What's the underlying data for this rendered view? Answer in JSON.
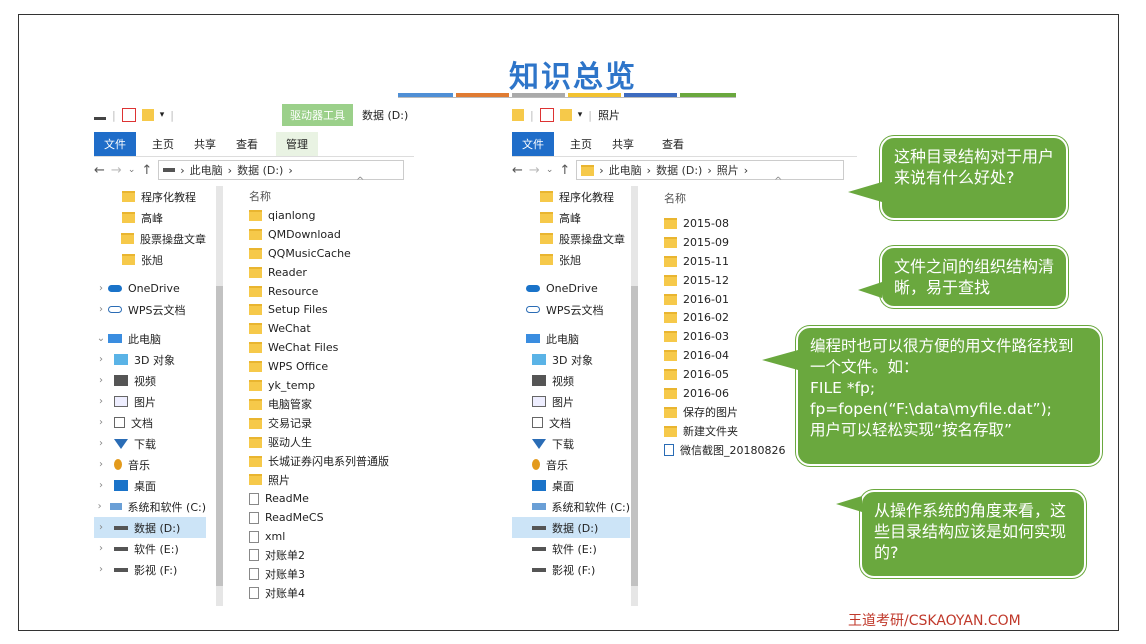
{
  "title": "知识总览",
  "colors": {
    "blue": "#4f8fd5",
    "orange": "#e07b32",
    "gray": "#aaaaaa",
    "yellow": "#f2c230",
    "darkblue": "#3d6bbf",
    "green": "#6aa83e"
  },
  "left": {
    "ctx_tab": "驱动器工具",
    "window_title": "数据 (D:)",
    "tabs": [
      "文件",
      "主页",
      "共享",
      "查看",
      "管理"
    ],
    "path": [
      "此电脑",
      "数据 (D:)"
    ],
    "nav": [
      {
        "label": "程序化教程",
        "icon": "folder"
      },
      {
        "label": "高峰",
        "icon": "folder"
      },
      {
        "label": "股票操盘文章",
        "icon": "folder"
      },
      {
        "label": "张旭",
        "icon": "folder"
      },
      {
        "label": "OneDrive",
        "icon": "cloud"
      },
      {
        "label": "WPS云文档",
        "icon": "cloud-outline"
      },
      {
        "label": "此电脑",
        "icon": "pc"
      },
      {
        "label": "3D 对象",
        "icon": "3d"
      },
      {
        "label": "视频",
        "icon": "video"
      },
      {
        "label": "图片",
        "icon": "picture"
      },
      {
        "label": "文档",
        "icon": "document"
      },
      {
        "label": "下载",
        "icon": "download"
      },
      {
        "label": "音乐",
        "icon": "music"
      },
      {
        "label": "桌面",
        "icon": "desktop"
      },
      {
        "label": "系统和软件 (C:)",
        "icon": "drive-c"
      },
      {
        "label": "数据 (D:)",
        "icon": "drive"
      },
      {
        "label": "软件 (E:)",
        "icon": "drive"
      },
      {
        "label": "影视 (F:)",
        "icon": "drive"
      }
    ],
    "column_header": "名称",
    "files": [
      {
        "name": "qianlong",
        "icon": "folder"
      },
      {
        "name": "QMDownload",
        "icon": "folder"
      },
      {
        "name": "QQMusicCache",
        "icon": "folder"
      },
      {
        "name": "Reader",
        "icon": "folder"
      },
      {
        "name": "Resource",
        "icon": "folder"
      },
      {
        "name": "Setup Files",
        "icon": "folder"
      },
      {
        "name": "WeChat",
        "icon": "folder"
      },
      {
        "name": "WeChat Files",
        "icon": "folder"
      },
      {
        "name": "WPS Office",
        "icon": "folder"
      },
      {
        "name": "yk_temp",
        "icon": "folder"
      },
      {
        "name": "电脑管家",
        "icon": "folder"
      },
      {
        "name": "交易记录",
        "icon": "folder"
      },
      {
        "name": "驱动人生",
        "icon": "folder"
      },
      {
        "name": "长城证券闪电系列普通版",
        "icon": "folder"
      },
      {
        "name": "照片",
        "icon": "folder"
      },
      {
        "name": "ReadMe",
        "icon": "doc"
      },
      {
        "name": "ReadMeCS",
        "icon": "doc"
      },
      {
        "name": "xml",
        "icon": "doc"
      },
      {
        "name": "对账单2",
        "icon": "doc"
      },
      {
        "name": "对账单3",
        "icon": "doc"
      },
      {
        "name": "对账单4",
        "icon": "doc"
      }
    ]
  },
  "right": {
    "window_title": "照片",
    "tabs": [
      "文件",
      "主页",
      "共享",
      "查看"
    ],
    "path": [
      "此电脑",
      "数据 (D:)",
      "照片"
    ],
    "nav": [
      {
        "label": "程序化教程",
        "icon": "folder"
      },
      {
        "label": "高峰",
        "icon": "folder"
      },
      {
        "label": "股票操盘文章",
        "icon": "folder"
      },
      {
        "label": "张旭",
        "icon": "folder"
      },
      {
        "label": "OneDrive",
        "icon": "cloud"
      },
      {
        "label": "WPS云文档",
        "icon": "cloud-outline"
      },
      {
        "label": "此电脑",
        "icon": "pc"
      },
      {
        "label": "3D 对象",
        "icon": "3d"
      },
      {
        "label": "视频",
        "icon": "video"
      },
      {
        "label": "图片",
        "icon": "picture"
      },
      {
        "label": "文档",
        "icon": "document"
      },
      {
        "label": "下载",
        "icon": "download"
      },
      {
        "label": "音乐",
        "icon": "music"
      },
      {
        "label": "桌面",
        "icon": "desktop"
      },
      {
        "label": "系统和软件 (C:)",
        "icon": "drive-c"
      },
      {
        "label": "数据 (D:)",
        "icon": "drive"
      },
      {
        "label": "软件 (E:)",
        "icon": "drive"
      },
      {
        "label": "影视 (F:)",
        "icon": "drive"
      }
    ],
    "column_header": "名称",
    "files": [
      {
        "name": "2015-08",
        "icon": "folder"
      },
      {
        "name": "2015-09",
        "icon": "folder"
      },
      {
        "name": "2015-11",
        "icon": "folder"
      },
      {
        "name": "2015-12",
        "icon": "folder"
      },
      {
        "name": "2016-01",
        "icon": "folder"
      },
      {
        "name": "2016-02",
        "icon": "folder"
      },
      {
        "name": "2016-03",
        "icon": "folder"
      },
      {
        "name": "2016-04",
        "icon": "folder"
      },
      {
        "name": "2016-05",
        "icon": "folder"
      },
      {
        "name": "2016-06",
        "icon": "folder"
      },
      {
        "name": "保存的图片",
        "icon": "folder"
      },
      {
        "name": "新建文件夹",
        "icon": "folder"
      },
      {
        "name": "微信截图_20180826",
        "icon": "image"
      }
    ]
  },
  "bubbles": {
    "b1": "这种目录结构对于用户来说有什么好处?",
    "b2": "文件之间的组织结构清晰，易于查找",
    "b3": "编程时也可以很方便的用文件路径找到一个文件。如：\nFILE *fp;\nfp=fopen(“F:\\data\\myfile.dat”);\n用户可以轻松实现“按名存取”",
    "b4": "从操作系统的角度来看，这些目录结构应该是如何实现的?"
  },
  "footer": "王道考研/CSKAOYAN.COM"
}
